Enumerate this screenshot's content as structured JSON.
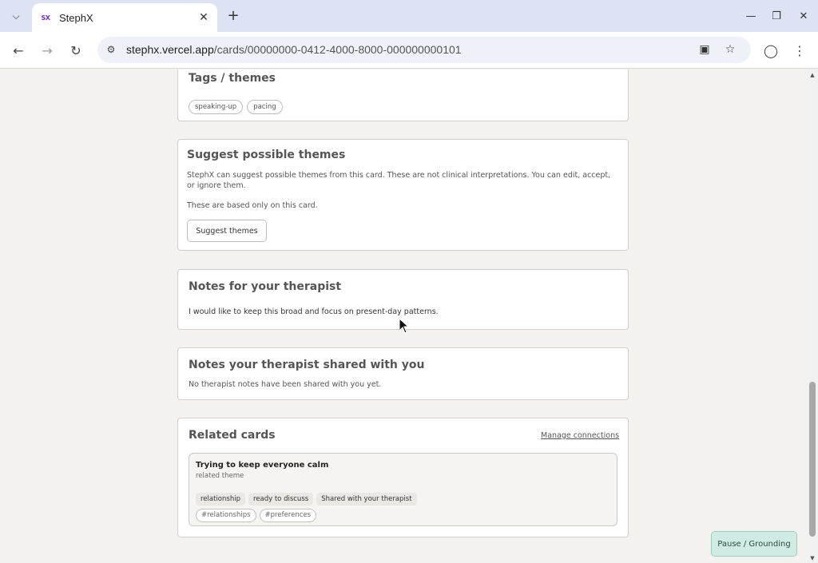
{
  "browser": {
    "tab_title": "StephX",
    "favicon_text": "SX",
    "url_host": "stephx.vercel.app",
    "url_path": "/cards/00000000-0412-4000-8000-000000000101"
  },
  "tags_card": {
    "title": "Tags / themes",
    "tags": [
      "speaking-up",
      "pacing"
    ]
  },
  "suggest_card": {
    "title": "Suggest possible themes",
    "description": "StephX can suggest possible themes from this card. These are not clinical interpretations. You can edit, accept, or ignore them.",
    "note": "These are based only on this card.",
    "button_label": "Suggest themes"
  },
  "notes_card": {
    "title": "Notes for your therapist",
    "text": "I would like to keep this broad and focus on present-day patterns."
  },
  "shared_card": {
    "title": "Notes your therapist shared with you",
    "text": "No therapist notes have been shared with you yet."
  },
  "related_card": {
    "title": "Related cards",
    "manage_link": "Manage connections",
    "items": [
      {
        "title": "Trying to keep everyone calm",
        "subtitle": "related theme",
        "chips": [
          "relationship",
          "ready to discuss",
          "Shared with your therapist"
        ],
        "tags": [
          "#relationships",
          "#preferences"
        ]
      }
    ]
  },
  "pause_button": "Pause / Grounding",
  "colors": {
    "page_bg": "#f3f2ee",
    "tabbar_bg": "#dde3f2",
    "pause_bg": "#cfece4"
  }
}
